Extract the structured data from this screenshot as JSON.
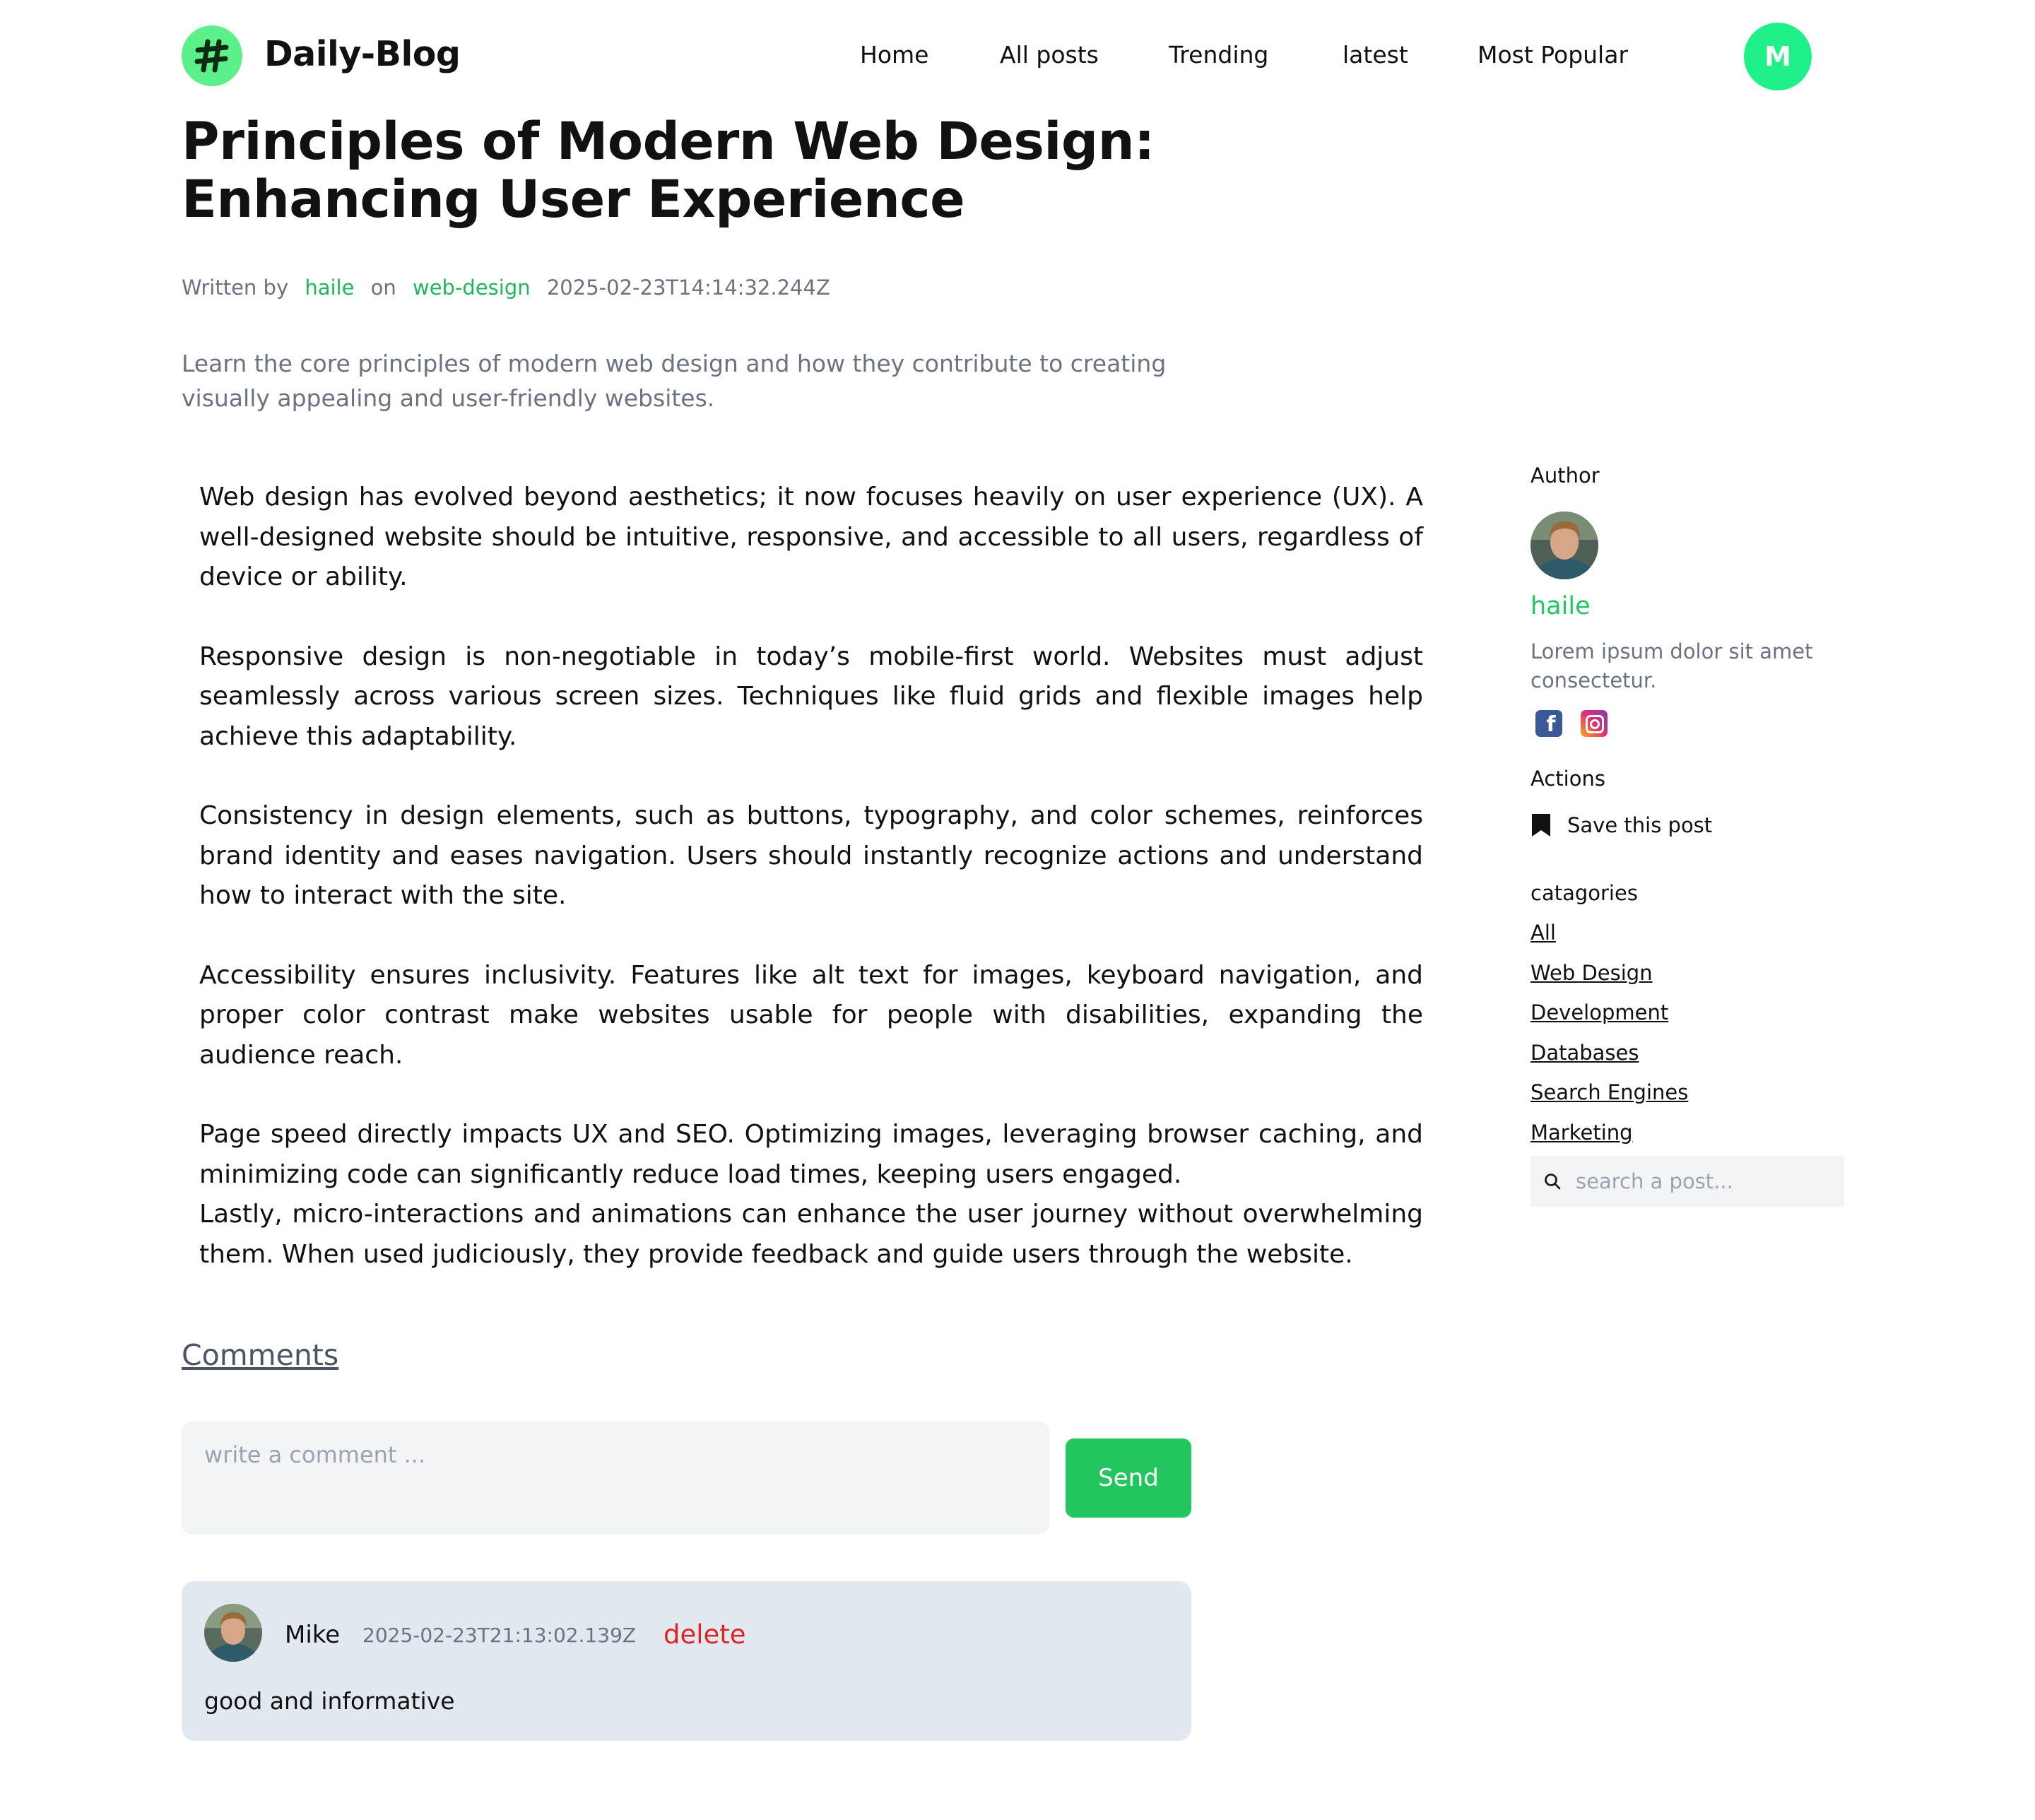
{
  "brand": {
    "name": "Daily-Blog",
    "logo_icon": "hashtag-icon",
    "accent_color": "#22c55e"
  },
  "nav": {
    "items": [
      {
        "label": "Home"
      },
      {
        "label": "All posts"
      },
      {
        "label": "Trending"
      },
      {
        "label": "latest"
      },
      {
        "label": "Most Popular"
      }
    ],
    "profile_initial": "M"
  },
  "post": {
    "title": "Principles of Modern Web Design: Enhancing User Experience",
    "meta": {
      "written_by": "Written by",
      "author": "haile",
      "on": "on",
      "category": "web-design",
      "date": "2025-02-23T14:14:32.244Z"
    },
    "summary": "Learn the core principles of modern web design and how they contribute to creating visually appealing and user-friendly websites.",
    "paragraphs": [
      "Web design has evolved beyond aesthetics; it now focuses heavily on user experience (UX). A well-designed website should be intuitive, responsive, and accessible to all users, regardless of device or ability.",
      "Responsive design is non-negotiable in today’s mobile-first world. Websites must adjust seamlessly across various screen sizes. Techniques like fluid grids and flexible images help achieve this adaptability.",
      "Consistency in design elements, such as buttons, typography, and color schemes, reinforces brand identity and eases navigation. Users should instantly recognize actions and understand how to interact with the site.",
      "Accessibility ensures inclusivity. Features like alt text for images, keyboard navigation, and proper color contrast make websites usable for people with disabilities, expanding the audience reach.",
      "Page speed directly impacts UX and SEO. Optimizing images, leveraging browser caching, and minimizing code can significantly reduce load times, keeping users engaged.",
      "Lastly, micro-interactions and animations can enhance the user journey without overwhelming them. When used judiciously, they provide feedback and guide users through the website."
    ]
  },
  "sidebar": {
    "author_label": "Author",
    "author_name": "haile",
    "author_bio": "Lorem ipsum dolor sit amet consectetur.",
    "social": [
      "facebook-icon",
      "instagram-icon"
    ],
    "actions_label": "Actions",
    "save_label": "Save this post",
    "categories_label": "catagories",
    "categories": [
      "All",
      "Web Design",
      "Development",
      "Databases",
      "Search Engines",
      "Marketing"
    ],
    "search_placeholder": "search a post..."
  },
  "comments": {
    "title": "Comments",
    "input_placeholder": "write a comment ...",
    "send_label": "Send",
    "items": [
      {
        "name": "Mike",
        "time": "2025-02-23T21:13:02.139Z",
        "delete_label": "delete",
        "text": "good and informative"
      }
    ]
  }
}
